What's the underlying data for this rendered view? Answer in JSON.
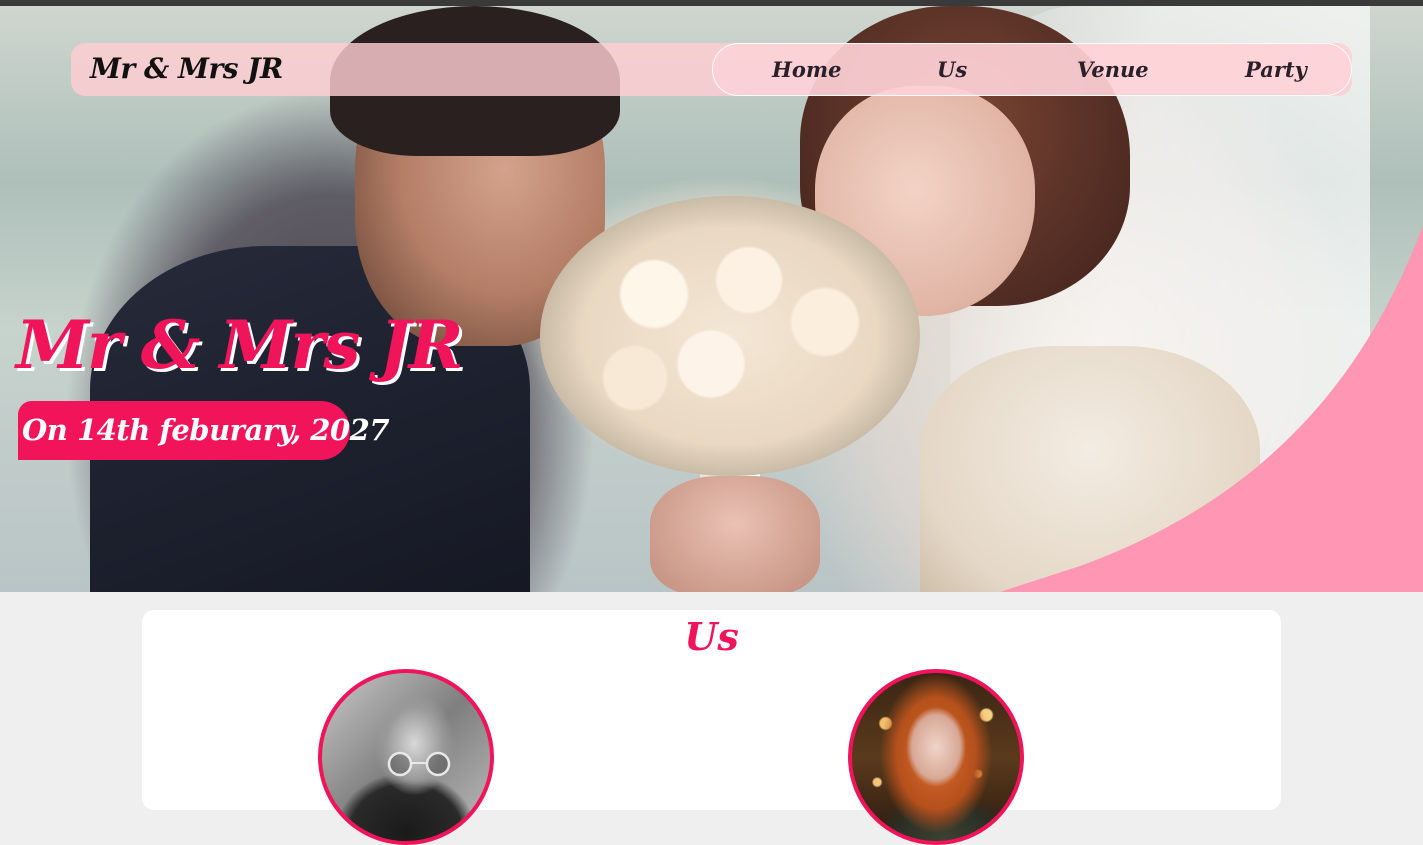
{
  "nav": {
    "brand": "Mr & Mrs JR",
    "links": [
      "Home",
      "Us",
      "Venue",
      "Party"
    ]
  },
  "hero": {
    "title": "Mr & Mrs JR",
    "date": "On 14th feburary, 2027"
  },
  "us": {
    "title": "Us"
  },
  "colors": {
    "accent": "#f0145a",
    "nav_bg": "#ffcdd2",
    "hero_curve": "#ff96b4",
    "page_bg": "#efefef"
  }
}
